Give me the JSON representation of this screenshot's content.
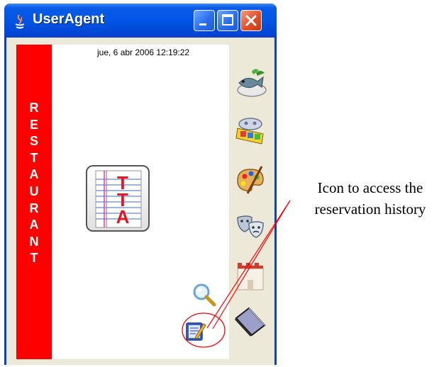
{
  "window": {
    "title": "UserAgent",
    "titlebar_color": "#0055e5",
    "controls": [
      "minimize-icon",
      "maximize-icon",
      "close-icon"
    ]
  },
  "main": {
    "datetime": "jue, 6 abr 2006 12:19:22",
    "side_label_letters": [
      "R",
      "E",
      "S",
      "T",
      "A",
      "U",
      "R",
      "A",
      "N",
      "T"
    ],
    "side_label_color": "#ff0000",
    "center_icon_letters": [
      "T",
      "T",
      "A"
    ]
  },
  "icon_column": {
    "items": [
      "restaurant-fish-icon",
      "cinema-film-icon",
      "art-palette-icon",
      "theatre-masks-icon",
      "museum-castle-icon",
      "book-icon"
    ]
  },
  "tools": [
    "search-icon",
    "reservation-history-icon"
  ],
  "annotation": {
    "line1": "Icon to access the",
    "line2": "reservation history",
    "highlight_color": "#ff0000"
  }
}
